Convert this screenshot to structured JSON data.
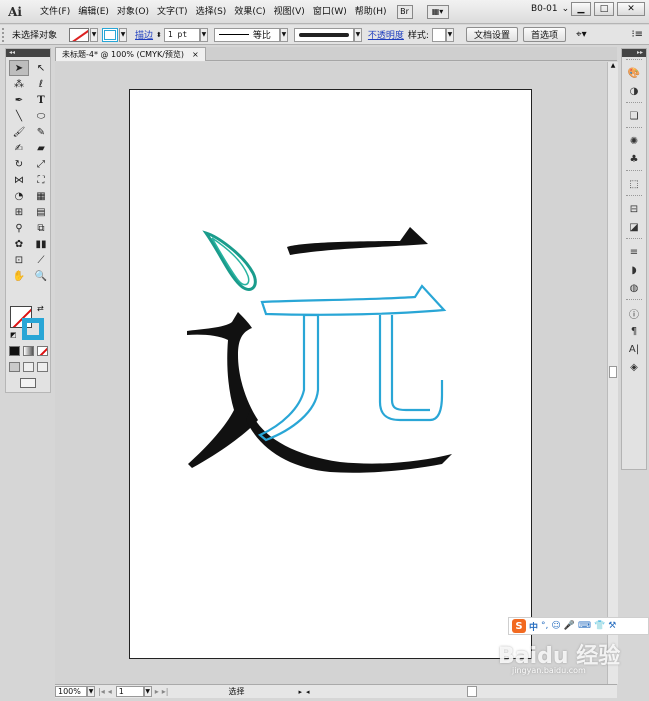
{
  "app": {
    "logo": "Ai",
    "menus": [
      "文件(F)",
      "编辑(E)",
      "对象(O)",
      "文字(T)",
      "选择(S)",
      "效果(C)",
      "视图(V)",
      "窗口(W)",
      "帮助(H)"
    ],
    "workspace": "B0-01"
  },
  "controlbar": {
    "selection": "未选择对象",
    "stroke_label": "描边",
    "stroke_weight": "1 pt",
    "profile": "等比",
    "opacity_label": "不透明度",
    "style_label": "样式:",
    "doc_setup": "文档设置",
    "prefs": "首选项"
  },
  "document": {
    "tab_title": "未标题-4* @ 100% (CMYK/预览)"
  },
  "statusbar": {
    "zoom": "100%",
    "page": "1",
    "tool_status": "选择"
  },
  "ime": {
    "label": "中"
  },
  "watermark": {
    "brand": "Baidu 经验",
    "url": "jingyan.baidu.com"
  },
  "colors": {
    "accent_blue": "#29a6d6",
    "teal": "#1a9c8c",
    "ink": "#111111"
  }
}
